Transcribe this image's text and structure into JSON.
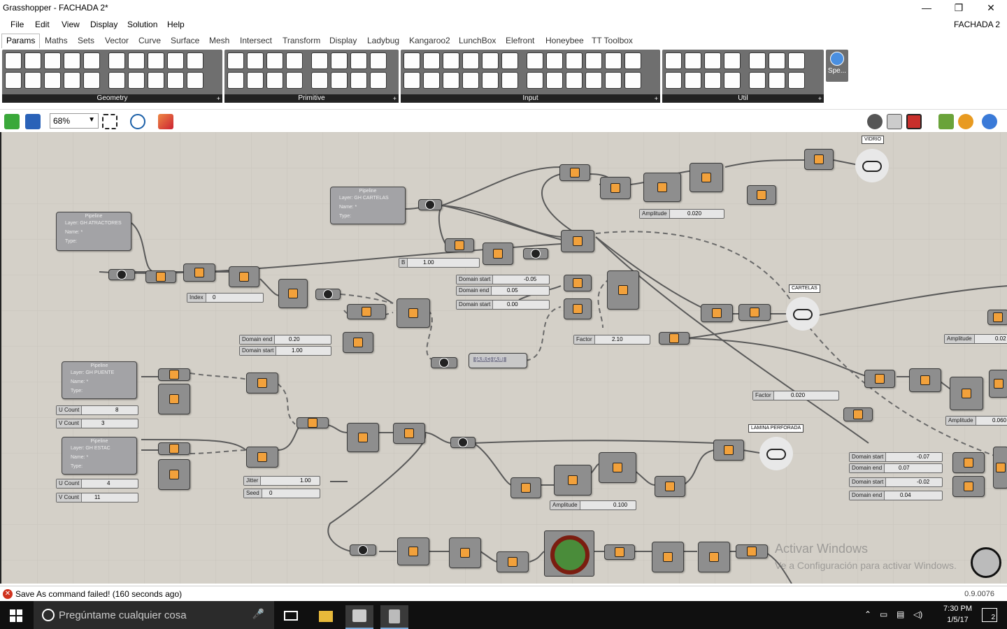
{
  "window": {
    "title": "Grasshopper - FACHADA 2*",
    "minimize": "—",
    "maximize": "❐",
    "close": "✕"
  },
  "menu": {
    "items": [
      "File",
      "Edit",
      "View",
      "Display",
      "Solution",
      "Help"
    ],
    "document_name": "FACHADA 2"
  },
  "tabs": [
    "Params",
    "Maths",
    "Sets",
    "Vector",
    "Curve",
    "Surface",
    "Mesh",
    "Intersect",
    "Transform",
    "Display",
    "Ladybug",
    "Kangaroo2",
    "LunchBox",
    "Elefront",
    "Honeybee",
    "TT Toolbox"
  ],
  "active_tab": "Params",
  "ribbon": {
    "panels": [
      "Geometry",
      "Primitive",
      "Input",
      "Util"
    ],
    "extra_panel_label": "Spe...",
    "expand_glyph": "+"
  },
  "canvas_toolbar": {
    "zoom": "68%",
    "icons": [
      "open-file-icon",
      "save-file-icon",
      "zoom-extents-icon",
      "preview-eye-icon",
      "sketch-icon"
    ]
  },
  "canvas": {
    "pipelines": [
      {
        "title": "Pipeline",
        "layer": "Layer:  GH ATRACTORES",
        "name": "Name:  *",
        "type": "Type:"
      },
      {
        "title": "Pipeline",
        "layer": "Layer:  GH CARTELAS",
        "name": "Name:  *",
        "type": "Type:"
      },
      {
        "title": "Pipeline",
        "layer": "Layer:  GH PUENTE",
        "name": "Name:  *",
        "type": "Type:"
      },
      {
        "title": "Pipeline",
        "layer": "Layer:  GH ESTAC",
        "name": "Name:  *",
        "type": "Type:"
      }
    ],
    "sliders": [
      {
        "label": "Index",
        "value": "0"
      },
      {
        "label": "Domain end",
        "value": "0.20"
      },
      {
        "label": "Domain start",
        "value": "1.00"
      },
      {
        "label": "U Count",
        "value": "8"
      },
      {
        "label": "V Count",
        "value": "3"
      },
      {
        "label": "U Count",
        "value": "4"
      },
      {
        "label": "V Count",
        "value": "11"
      },
      {
        "label": "Jitter",
        "value": "1.00"
      },
      {
        "label": "Seed",
        "value": "0"
      },
      {
        "label": "B",
        "value": "1.00"
      },
      {
        "label": "Domain start",
        "value": "-0.05"
      },
      {
        "label": "Domain end",
        "value": "0.05"
      },
      {
        "label": "Domain start",
        "value": "0.00"
      },
      {
        "label": "Factor",
        "value": "2.10"
      },
      {
        "label": "Amplitude",
        "value": "0.020"
      },
      {
        "label": "Amplitude",
        "value": "0.100"
      },
      {
        "label": "Factor",
        "value": "0.020"
      },
      {
        "label": "Amplitude",
        "value": "0.060"
      },
      {
        "label": "Amplitude",
        "value": "0.02"
      },
      {
        "label": "Domain start",
        "value": "-0.07"
      },
      {
        "label": "Domain end",
        "value": "0.07"
      },
      {
        "label": "Domain start",
        "value": "-0.02"
      },
      {
        "label": "Domain end",
        "value": "0.04"
      }
    ],
    "tags": [
      "VIDRIO",
      "CARTELAS",
      "LAMINA PERFORADA"
    ],
    "panel_text": "{A;B;C}  {A;B}",
    "watermark_title": "Activar Windows",
    "watermark_sub": "Ve a Configuración para activar Windows."
  },
  "status": {
    "message": "Save As command failed! (160 seconds ago)",
    "version": "0.9.0076",
    "error_glyph": "✕"
  },
  "taskbar": {
    "search_placeholder": "Pregúntame cualquier cosa",
    "time": "7:30 PM",
    "date": "1/5/17",
    "notifications": "2"
  }
}
